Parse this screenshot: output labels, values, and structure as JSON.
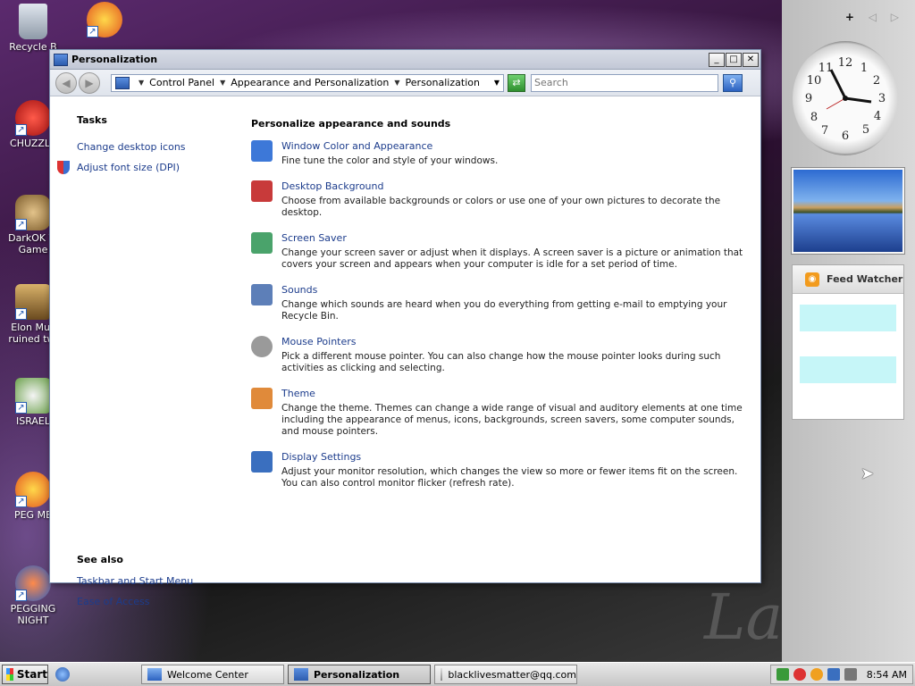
{
  "desktop": {
    "watermark": "La",
    "icons": [
      {
        "label": "Recycle B",
        "name": "recycle-bin-icon"
      },
      {
        "label": "",
        "name": "peggle-icon"
      },
      {
        "label": "CHUZZLE",
        "name": "chuzzle-icon"
      },
      {
        "label": "DarkOK Vi Game",
        "name": "darkok-game-icon"
      },
      {
        "label": "Elon Mus ruined twi",
        "name": "box-game-icon"
      },
      {
        "label": "ISRAEL",
        "name": "israel-game-icon"
      },
      {
        "label": "PEG ME",
        "name": "peg-me-icon"
      },
      {
        "label": "PEGGING NIGHT",
        "name": "pegging-night-icon"
      }
    ]
  },
  "sidebar": {
    "add_label": "+",
    "prev_label": "◁",
    "next_label": "▷",
    "feed_title": "Feed Watcher"
  },
  "window": {
    "title": "Personalization",
    "minimize": "_",
    "maximize": "□",
    "close": "✕",
    "address": {
      "crumbs": [
        "Control Panel",
        "Appearance and Personalization",
        "Personalization"
      ]
    },
    "search_placeholder": "Search",
    "tasks_heading": "Tasks",
    "tasks": [
      "Change desktop icons",
      "Adjust font size (DPI)"
    ],
    "see_also_heading": "See also",
    "see_also": [
      "Taskbar and Start Menu",
      "Ease of Access"
    ],
    "main_heading": "Personalize appearance and sounds",
    "items": [
      {
        "name": "Window Color and Appearance",
        "desc": "Fine tune the color and style of your windows.",
        "icon": "window-color-icon",
        "color": "#3d78d8"
      },
      {
        "name": "Desktop Background",
        "desc": "Choose from available backgrounds or colors or use one of your own pictures to decorate the desktop.",
        "icon": "desktop-background-icon",
        "color": "#c83a3a"
      },
      {
        "name": "Screen Saver",
        "desc": "Change your screen saver or adjust when it displays. A screen saver is a picture or animation that covers your screen and appears when your computer is idle for a set period of time.",
        "icon": "screen-saver-icon",
        "color": "#4aa36b"
      },
      {
        "name": "Sounds",
        "desc": "Change which sounds are heard when you do everything from getting e-mail to emptying your Recycle Bin.",
        "icon": "sounds-icon",
        "color": "#5d7fb8"
      },
      {
        "name": "Mouse Pointers",
        "desc": "Pick a different mouse pointer. You can also change how the mouse pointer looks during such activities as clicking and selecting.",
        "icon": "mouse-pointer-icon",
        "color": "#9a9a9a"
      },
      {
        "name": "Theme",
        "desc": "Change the theme. Themes can change a wide range of visual and auditory elements at one time including the appearance of menus, icons, backgrounds, screen savers, some computer sounds, and mouse pointers.",
        "icon": "theme-icon",
        "color": "#e08a3a"
      },
      {
        "name": "Display Settings",
        "desc": "Adjust your monitor resolution, which changes the view so more or fewer items fit on the screen. You can also control monitor flicker (refresh rate).",
        "icon": "display-settings-icon",
        "color": "#3a6fbf"
      }
    ]
  },
  "taskbar": {
    "start_label": "Start",
    "buttons": [
      {
        "label": "Welcome Center",
        "active": false
      },
      {
        "label": "Personalization",
        "active": true
      },
      {
        "label": "blacklivesmatter@qq.com",
        "active": false
      }
    ],
    "clock": "8:54 AM"
  }
}
